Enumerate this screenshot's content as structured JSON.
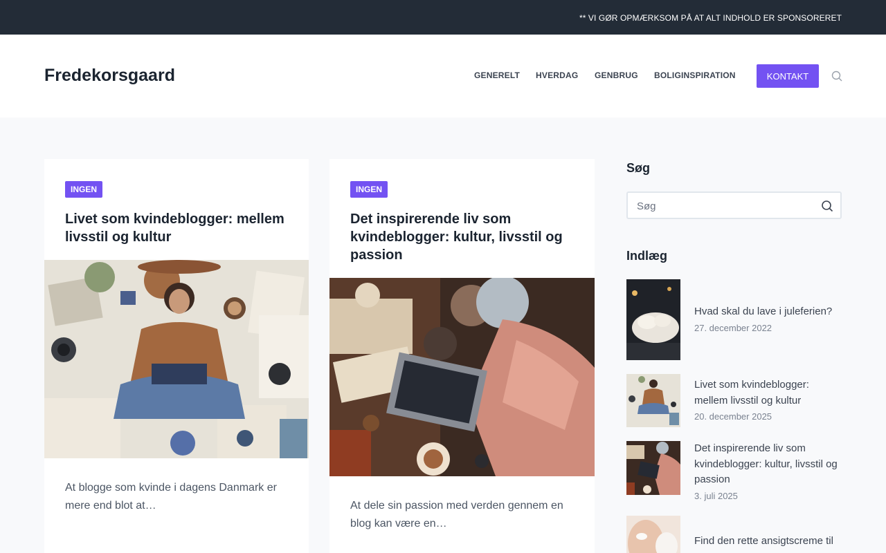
{
  "topbar": {
    "notice": "** VI GØR OPMÆRKSOM PÅ AT ALT INDHOLD ER SPONSORERET"
  },
  "header": {
    "site_title": "Fredekorsgaard",
    "nav": [
      "GENERELT",
      "HVERDAG",
      "GENBRUG",
      "BOLIGINSPIRATION"
    ],
    "contact_label": "KONTAKT"
  },
  "posts": [
    {
      "category": "INGEN",
      "title": "Livet som kvindeblogger: mellem livsstil og kultur",
      "excerpt": "At blogge som kvinde i dagens Danmark er mere end blot at…"
    },
    {
      "category": "INGEN",
      "title": "Det inspirerende liv som kvindeblogger: kultur, livsstil og passion",
      "excerpt": "At dele sin passion med verden gennem en blog kan være en…"
    }
  ],
  "sidebar": {
    "search_title": "Søg",
    "search_placeholder": "Søg",
    "posts_title": "Indlæg",
    "recent": [
      {
        "title": "Hvad skal du lave i juleferien?",
        "date": "27. december 2022"
      },
      {
        "title": "Livet som kvindeblogger: mellem livsstil og kultur",
        "date": "20. december 2025"
      },
      {
        "title": "Det inspirerende liv som kvindeblogger: kultur, livsstil og passion",
        "date": "3. juli 2025"
      },
      {
        "title": "Find den rette ansigtscreme til",
        "date": ""
      }
    ]
  },
  "colors": {
    "accent": "#7352f2",
    "topbar": "#232c37"
  }
}
